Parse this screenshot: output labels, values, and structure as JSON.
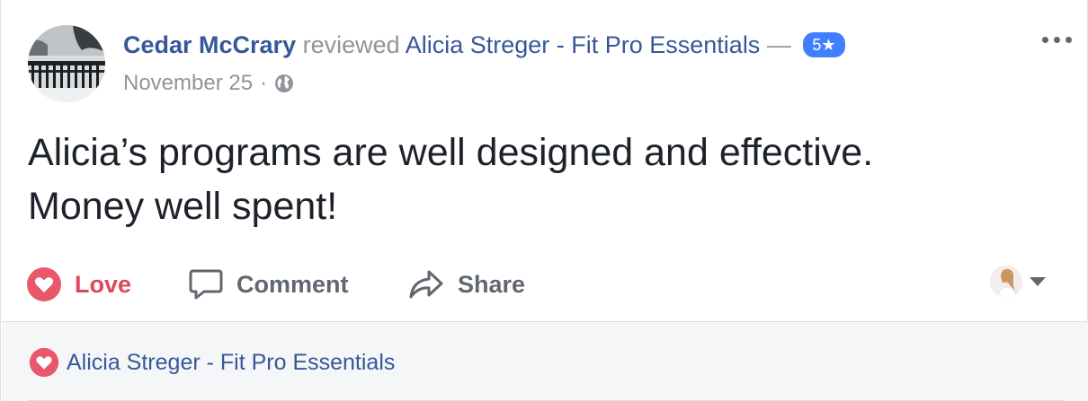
{
  "post": {
    "author": "Cedar McCrary",
    "verb": "reviewed",
    "page_name": "Alicia Streger - Fit Pro Essentials",
    "dash": "—",
    "rating": "5★",
    "date": "November 25",
    "separator": "·",
    "privacy_icon": "globe-icon",
    "text_line1": "Alicia’s programs are well designed and effective.",
    "text_line2": "Money well spent!"
  },
  "actions": {
    "love_label": "Love",
    "comment_label": "Comment",
    "share_label": "Share"
  },
  "reactions": {
    "reactor_name": "Alicia Streger - Fit Pro Essentials"
  },
  "colors": {
    "link": "#365899",
    "love": "#e0475b",
    "badge": "#4080ff",
    "muted": "#90949c"
  }
}
